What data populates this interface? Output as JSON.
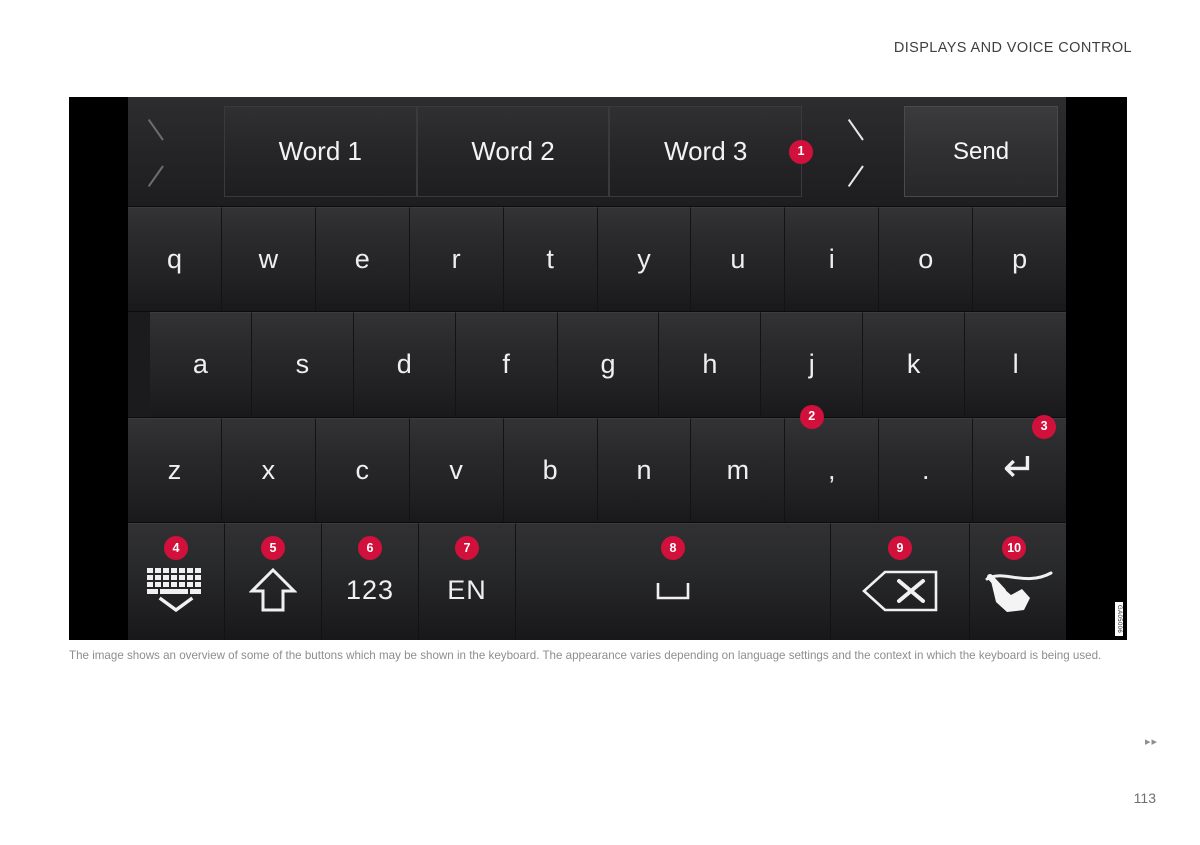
{
  "header": {
    "title": "DISPLAYS AND VOICE CONTROL"
  },
  "keyboard": {
    "suggestion_row": {
      "prev_icon": "chevron-left-icon",
      "next_icon": "chevron-right-icon",
      "words": [
        "Word 1",
        "Word 2",
        "Word 3"
      ],
      "send_label": "Send"
    },
    "rows": [
      [
        "q",
        "w",
        "e",
        "r",
        "t",
        "y",
        "u",
        "i",
        "o",
        "p"
      ],
      [
        "a",
        "s",
        "d",
        "f",
        "g",
        "h",
        "j",
        "k",
        "l"
      ],
      [
        "z",
        "x",
        "c",
        "v",
        "b",
        "n",
        "m",
        ",",
        ".",
        "↵"
      ]
    ],
    "function_row": [
      {
        "name": "hide-keyboard-key",
        "icon": "keyboard-down-icon",
        "label": ""
      },
      {
        "name": "shift-key",
        "icon": "shift-arrow-up-icon",
        "label": ""
      },
      {
        "name": "numbers-key",
        "icon": "text-icon",
        "label": "123"
      },
      {
        "name": "language-key",
        "icon": "text-icon",
        "label": "EN"
      },
      {
        "name": "space-key",
        "icon": "space-bar-icon",
        "label": ""
      },
      {
        "name": "backspace-key",
        "icon": "backspace-x-icon",
        "label": ""
      },
      {
        "name": "handwriting-key",
        "icon": "handwriting-stylus-icon",
        "label": ""
      }
    ]
  },
  "callouts": {
    "one": "1",
    "two": "2",
    "three": "3",
    "four": "4",
    "five": "5",
    "six": "6",
    "seven": "7",
    "eight": "8",
    "nine": "9",
    "ten": "10"
  },
  "figure": {
    "code": "GA05006"
  },
  "caption": {
    "text": "The image shows an overview of some of the buttons which may be shown in the keyboard. The appearance varies depending on language settings and the context in which the keyboard is being used."
  },
  "footer": {
    "arrows": "▸▸",
    "page_number": "113"
  },
  "colors": {
    "badge": "#d2103c",
    "panel": "#222224",
    "frame": "#000000",
    "text": "#efefef",
    "caption": "#8d8e91"
  }
}
